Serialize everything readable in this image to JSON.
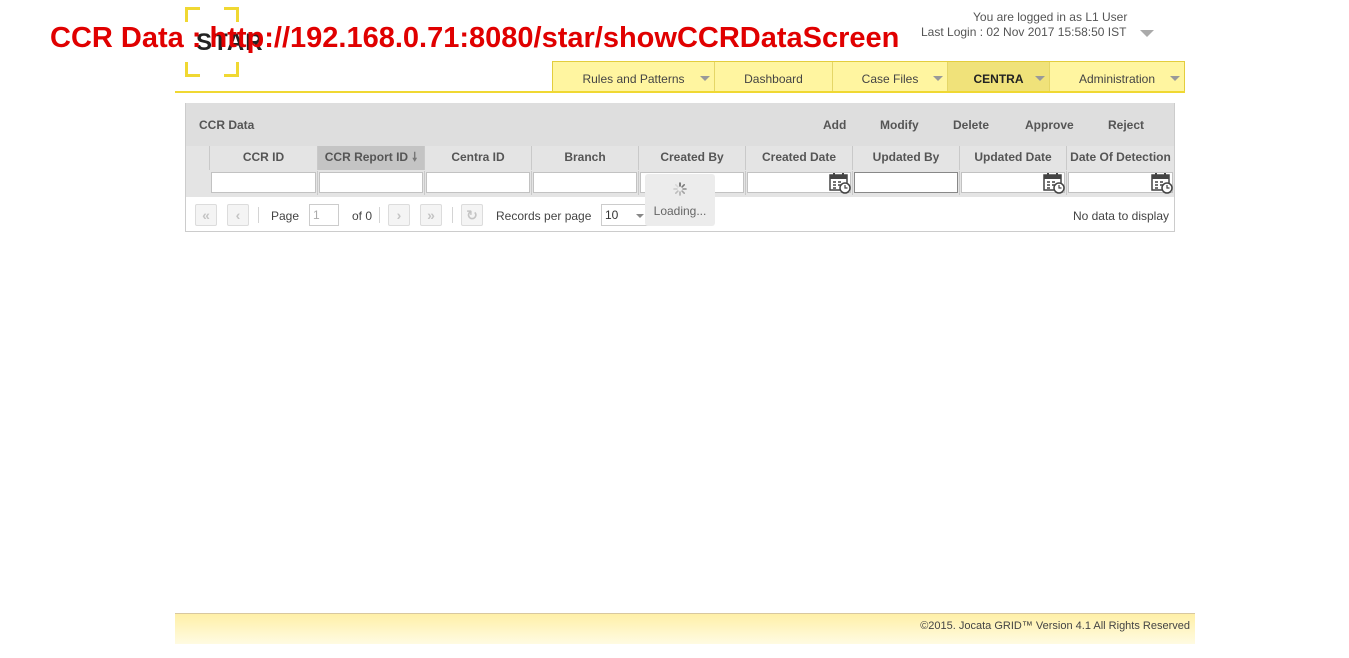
{
  "overlay_title": "CCR Data : http://192.168.0.71:8080/star/showCCRDataScreen",
  "logo": {
    "text": "STAR"
  },
  "user": {
    "logged_in": "You are logged in as L1 User",
    "last_login": "Last Login : 02 Nov 2017 15:58:50 IST"
  },
  "nav": {
    "tabs": [
      {
        "label": "Rules and Patterns",
        "dropdown": true,
        "active": false
      },
      {
        "label": "Dashboard",
        "dropdown": false,
        "active": false
      },
      {
        "label": "Case Files",
        "dropdown": true,
        "active": false
      },
      {
        "label": "CENTRA",
        "dropdown": true,
        "active": true
      },
      {
        "label": "Administration",
        "dropdown": true,
        "active": false
      }
    ]
  },
  "panel": {
    "title": "CCR Data",
    "actions": {
      "add": "Add",
      "modify": "Modify",
      "delete": "Delete",
      "approve": "Approve",
      "reject": "Reject"
    }
  },
  "grid": {
    "columns": [
      "CCR ID",
      "CCR Report ID",
      "Centra ID",
      "Branch",
      "Created By",
      "Created Date",
      "Updated By",
      "Updated Date",
      "Date Of Detection"
    ],
    "sorted_column": "CCR Report ID",
    "sort_direction": "descending",
    "date_columns": [
      "Created Date",
      "Updated Date",
      "Date Of Detection"
    ]
  },
  "loading": "Loading...",
  "pager": {
    "page_label": "Page",
    "page_value": "1",
    "of_label": "of 0",
    "records_label": "Records per page",
    "records_value": "10",
    "no_data": "No data to display"
  },
  "footer": "©2015. Jocata GRID™ Version 4.1 All Rights Reserved",
  "colors": {
    "accent": "#f0d832",
    "nav_bg": "#fff5a0",
    "overlay_red": "#e00000",
    "header_gray": "#dedede"
  }
}
